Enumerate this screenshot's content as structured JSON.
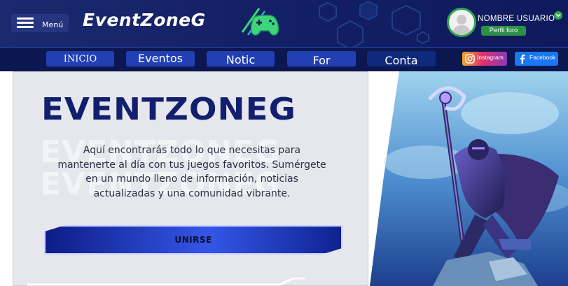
{
  "header": {
    "menu_label": "Menú",
    "logo_text": "EventZoneG",
    "user": {
      "name": "NOMBRE USUARIO",
      "profile_button": "Perfil foro"
    }
  },
  "nav": {
    "items": [
      {
        "label": "INICIO"
      },
      {
        "label": "Eventos"
      },
      {
        "label": "Notic"
      },
      {
        "label": "For"
      },
      {
        "label": "Conta"
      }
    ],
    "social": [
      {
        "label": "Instagram",
        "icon": "instagram-icon"
      },
      {
        "label": "Facebook",
        "icon": "facebook-icon"
      }
    ]
  },
  "hero": {
    "title": "EVENTZONEG",
    "ghost_lines": [
      "EVENTZONEG",
      "EVENTZONEG"
    ],
    "description": "Aquí encontrarás todo lo que necesitas para mantenerte al día con tus juegos favoritos. Sumérgete en un mundo lleno de información, noticias actualizadas y una comunidad vibrante.",
    "join_button": "UNIRSE"
  },
  "colors": {
    "header_bg": "#142066",
    "nav_bg": "#0c1650",
    "nav_button": "#2240b4",
    "brand_text": "#121f6e",
    "accent_green": "#2ea84a",
    "logo_icon": "#3ed47c",
    "card_bg": "#e6e7ec"
  }
}
